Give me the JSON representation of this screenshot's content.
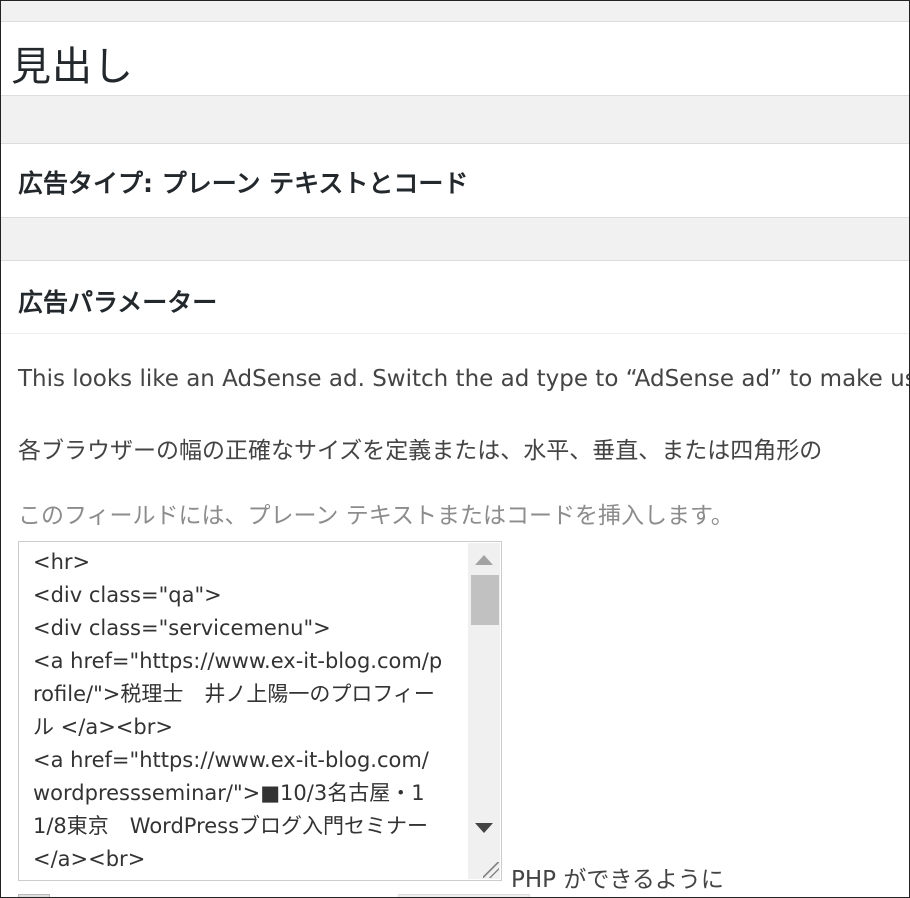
{
  "page_title": "見出し",
  "ad_type_heading": "広告タイプ: プレーン テキストとコード",
  "params_heading": "広告パラメーター",
  "notice_adsense": "This looks like an AdSense ad. Switch the ad type to “AdSense ad” to make use",
  "size_description": "各ブラウザーの幅の正確なサイズを定義または、水平、垂直、または四角形の",
  "field_description": "このフィールドには、プレーン テキストまたはコードを挿入します。",
  "code_content": "<hr>\n<div class=\"qa\">\n<div class=\"servicemenu\">\n<a href=\"https://www.ex-it-blog.com/profile/\">税理士　井ノ上陽一のプロフィール </a><br>\n<a href=\"https://www.ex-it-blog.com/wordpressseminar/\">■10/3名古屋・11/8東京　WordPressブログ入門セミナー </a><br>",
  "php_label": "PHP ができるように"
}
